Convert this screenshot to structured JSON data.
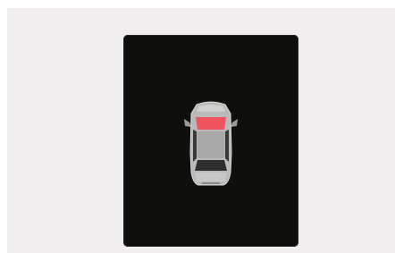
{
  "panel": {
    "background_color": "#f1eeef",
    "screen_color": "#0f0f0b"
  },
  "vehicle": {
    "icon": "car-top-view-icon",
    "body_color": "#b9b9b9",
    "highlight_part": "windshield",
    "highlight_color": "#f0545e"
  }
}
